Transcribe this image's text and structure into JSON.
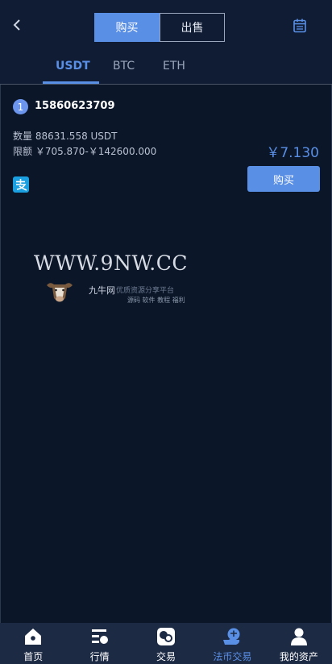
{
  "header": {
    "back_icon": "chevron-left-icon",
    "segments": [
      "购买",
      "出售"
    ],
    "active_segment": 0,
    "calendar_icon": "calendar-icon"
  },
  "coin_tabs": [
    "USDT",
    "BTC",
    "ETH"
  ],
  "active_coin_tab": 0,
  "offer": {
    "rank": "1",
    "username": "15860623709",
    "quantity": "数量 88631.558 USDT",
    "limit": "限额 ￥705.870-￥142600.000",
    "price": "￥7.130",
    "payment_icon": "alipay-icon",
    "buy_label": "购买"
  },
  "watermark": {
    "url": "WWW.9NW.CC",
    "name": "九牛网",
    "slogan": "优质资源分享平台",
    "tags": "源码 软件 教程 福利"
  },
  "bottom_nav": [
    {
      "label": "首页",
      "icon": "home-icon"
    },
    {
      "label": "行情",
      "icon": "market-icon"
    },
    {
      "label": "交易",
      "icon": "trade-icon"
    },
    {
      "label": "法币交易",
      "icon": "fiat-trade-icon"
    },
    {
      "label": "我的资产",
      "icon": "user-icon"
    }
  ],
  "active_nav": 3,
  "colors": {
    "accent": "#5a8fe6",
    "background": "#0b1628",
    "header": "#0f1c33",
    "bottom_nav": "#1c2a44"
  }
}
